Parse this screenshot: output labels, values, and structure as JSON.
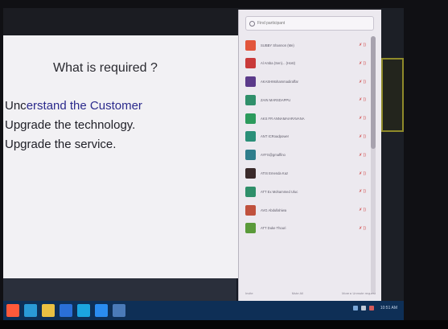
{
  "slide": {
    "title": "What is required ?",
    "bullets": [
      {
        "prefix": "Unc",
        "highlight": "erstand the Customer"
      },
      {
        "prefix": "",
        "highlight": "",
        "text": "Upgrade the technology."
      },
      {
        "prefix": "",
        "highlight": "",
        "text": "Upgrade the service."
      }
    ]
  },
  "panel": {
    "search": {
      "placeholder": "Find participant"
    },
    "participants": [
      {
        "color": "#e2553b",
        "letter": "",
        "name": "SUBBY Shannon (Me)",
        "mute": "✗ ))"
      },
      {
        "color": "#c93a3a",
        "letter": "",
        "name": "Al Amba (Sen)... (Host)",
        "mute": "✗ ))"
      },
      {
        "color": "#5b3a8a",
        "letter": "",
        "name": "AKASHMohammadiraffar",
        "mute": "✗ ))"
      },
      {
        "color": "#2f8f6a",
        "letter": "",
        "name": "ZAIN MARSDAPPU",
        "mute": "✗ ))"
      },
      {
        "color": "#2c9a5c",
        "letter": "",
        "name": "AKS FR ANNAMAIARAVANA",
        "mute": "✗ ))"
      },
      {
        "color": "#2a8f78",
        "letter": "",
        "name": "ANT ICRoadpower",
        "mute": "✗ ))"
      },
      {
        "color": "#2f7d8c",
        "letter": "",
        "name": "AYFS@gmaffino",
        "mute": "✗ ))"
      },
      {
        "color": "#3a2a2a",
        "letter": "",
        "name": "ATIS Emenda Kaz",
        "mute": "✗ ))"
      },
      {
        "color": "#2f8f6a",
        "letter": "",
        "name": "ATT Ex Mohammed Uluc",
        "mute": "✗ ))"
      },
      {
        "color": "#c0513d",
        "letter": "",
        "name": "AVG Abdullahiwa",
        "mute": "✗ ))"
      },
      {
        "color": "#5a9a3a",
        "letter": "",
        "name": "ATT Duke Thouri",
        "mute": "✗ ))"
      }
    ],
    "footer": {
      "left": "Invite",
      "middle": "Mute All",
      "right": "More ▸ Unmute request"
    }
  },
  "taskbar": {
    "icons": [
      {
        "name": "start",
        "color": "#ff5a3a"
      },
      {
        "name": "ie",
        "color": "#2a9ad7"
      },
      {
        "name": "folder",
        "color": "#e9c042"
      },
      {
        "name": "media",
        "color": "#2a6fd7"
      },
      {
        "name": "ie2",
        "color": "#1ba5e0"
      },
      {
        "name": "zoom",
        "color": "#2a8cf0"
      },
      {
        "name": "doc",
        "color": "#4a7ab8"
      }
    ],
    "time": "10:51 AM"
  }
}
